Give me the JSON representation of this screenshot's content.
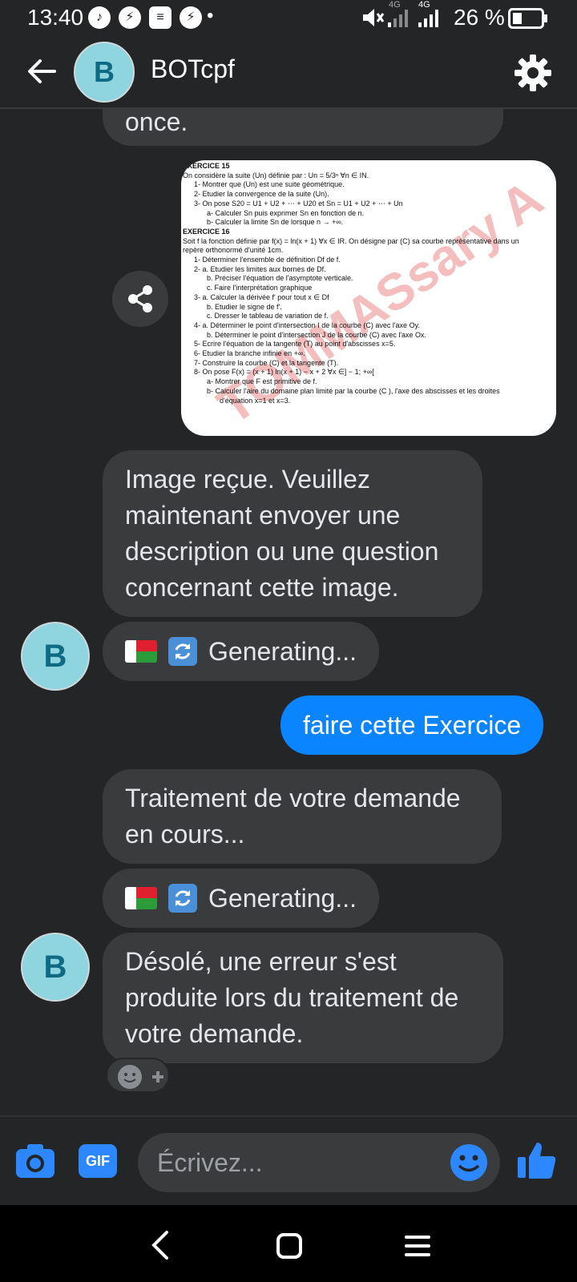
{
  "status_bar": {
    "time": "13:40",
    "network_1": "4G",
    "network_2": "4G",
    "battery": "26 %"
  },
  "header": {
    "avatar_letter": "B",
    "title": "BOTcpf"
  },
  "messages": {
    "partial_top": "once.",
    "image_exercise_15_title": "EXERCICE 15",
    "image_exercise_16_title": "EXERCICE 16",
    "watermark": "TOMMASsary A",
    "image_lines": [
      "On considère la suite (Un) définie par : Un = 5/3ⁿ ∀n ∈ IN.",
      "1- Montrer que (Un) est une suite géométrique.",
      "2- Etudier la convergence de la suite (Un).",
      "3- On pose S20 = U1 + U2 + ⋯ + U20 et Sn = U1 + U2 + ⋯ + Un",
      "a- Calculer Sn puis exprimer Sn en fonction de n.",
      "b- Calculer la limite Sn de lorsque n → +∞.",
      "Soit f la fonction définie par f(x) = ln(x + 1) ∀x ∈ IR. On désigne par (C) sa courbe représentative dans un",
      "repère orthonormé d'unité 1cm.",
      "1- Déterminer l'ensemble de définition Df de f.",
      "2- a. Etudier les limites aux bornes de Df.",
      "b. Préciser l'équation de l'asymptote verticale.",
      "c. Faire l'interprétation graphique",
      "3- a. Calculer la dérivée f' pour tout x ∈ Df",
      "b. Etudier le signe de f'.",
      "c. Dresser le tableau de variation de f.",
      "4- a. Déterminer le point d'intersection I de la courbe (C) avec l'axe Oy.",
      "b. Déterminer le point d'intersection J de la courbe (C) avec l'axe Ox.",
      "5- Ecrire l'équation de la tangente (T) au point d'abscisses x=5.",
      "6- Etudier la branche infinie en +∞.",
      "7- Construire la courbe (C) et la tangente (T).",
      "8- On pose F(x) = (x + 1) ln(x + 1) − x + 2 ∀x ∈] − 1; +∞[",
      "a- Montrer que F est primitive de f.",
      "b- Calculer l'aire du domaine plan limité par la courbe (C ), l'axe des abscisses et les droites",
      "d'équation x=1 et x=3."
    ],
    "image_received": "Image reçue. Veuillez maintenant envoyer une description ou une question concernant cette image.",
    "generating_1": "Generating...",
    "user_message": "faire cette Exercice",
    "processing": "Traitement de votre demande en cours...",
    "generating_2": "Generating...",
    "error": "Désolé, une erreur s'est produite lors du traitement de votre demande."
  },
  "composer": {
    "gif_label": "GIF",
    "placeholder": "Écrivez..."
  },
  "colors": {
    "background": "#242526",
    "bubble_bot": "#3a3b3c",
    "bubble_user": "#0a84ff",
    "accent_blue": "#2d88ff",
    "avatar_bg": "#8ed5e0"
  },
  "icons": [
    "back-arrow-icon",
    "settings-gear-icon",
    "share-icon",
    "camera-icon",
    "gif-icon",
    "emoji-icon",
    "thumbs-up-icon",
    "add-reaction-icon",
    "nav-back-icon",
    "nav-home-icon",
    "nav-menu-icon"
  ]
}
